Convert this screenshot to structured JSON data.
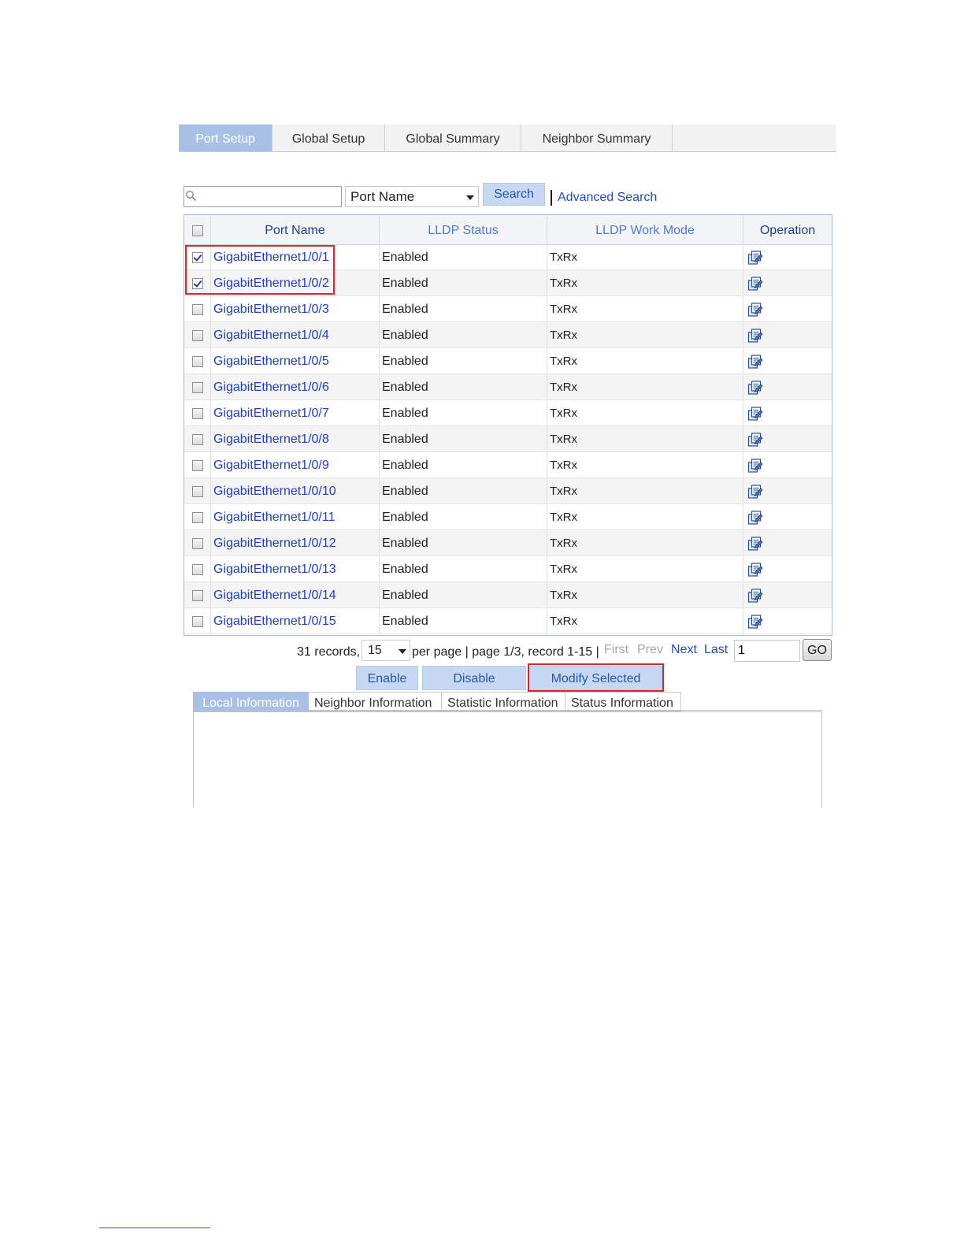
{
  "top_tabs": [
    {
      "label": "Port Setup",
      "active": true
    },
    {
      "label": "Global Setup",
      "active": false
    },
    {
      "label": "Global Summary",
      "active": false
    },
    {
      "label": "Neighbor Summary",
      "active": false
    }
  ],
  "search": {
    "value": "",
    "field": "Port Name",
    "button_label": "Search",
    "separator": "|",
    "advanced_label": "Advanced Search"
  },
  "table": {
    "headers": [
      "Port Name",
      "LLDP Status",
      "LLDP Work Mode",
      "Operation"
    ],
    "rows": [
      {
        "port": "GigabitEthernet1/0/1",
        "status": "Enabled",
        "mode": "TxRx",
        "checked": true
      },
      {
        "port": "GigabitEthernet1/0/2",
        "status": "Enabled",
        "mode": "TxRx",
        "checked": true
      },
      {
        "port": "GigabitEthernet1/0/3",
        "status": "Enabled",
        "mode": "TxRx",
        "checked": false
      },
      {
        "port": "GigabitEthernet1/0/4",
        "status": "Enabled",
        "mode": "TxRx",
        "checked": false
      },
      {
        "port": "GigabitEthernet1/0/5",
        "status": "Enabled",
        "mode": "TxRx",
        "checked": false
      },
      {
        "port": "GigabitEthernet1/0/6",
        "status": "Enabled",
        "mode": "TxRx",
        "checked": false
      },
      {
        "port": "GigabitEthernet1/0/7",
        "status": "Enabled",
        "mode": "TxRx",
        "checked": false
      },
      {
        "port": "GigabitEthernet1/0/8",
        "status": "Enabled",
        "mode": "TxRx",
        "checked": false
      },
      {
        "port": "GigabitEthernet1/0/9",
        "status": "Enabled",
        "mode": "TxRx",
        "checked": false
      },
      {
        "port": "GigabitEthernet1/0/10",
        "status": "Enabled",
        "mode": "TxRx",
        "checked": false
      },
      {
        "port": "GigabitEthernet1/0/11",
        "status": "Enabled",
        "mode": "TxRx",
        "checked": false
      },
      {
        "port": "GigabitEthernet1/0/12",
        "status": "Enabled",
        "mode": "TxRx",
        "checked": false
      },
      {
        "port": "GigabitEthernet1/0/13",
        "status": "Enabled",
        "mode": "TxRx",
        "checked": false
      },
      {
        "port": "GigabitEthernet1/0/14",
        "status": "Enabled",
        "mode": "TxRx",
        "checked": false
      },
      {
        "port": "GigabitEthernet1/0/15",
        "status": "Enabled",
        "mode": "TxRx",
        "checked": false
      }
    ],
    "operation_icon": "edit-icon"
  },
  "pager": {
    "records_text": "31 records,",
    "per_page_value": "15",
    "info_text": "per page | page 1/3, record 1-15 |",
    "first_label": "First",
    "prev_label": "Prev",
    "next_label": "Next",
    "last_label": "Last",
    "page_input_value": "1",
    "go_label": "GO"
  },
  "actions": {
    "enable_label": "Enable",
    "disable_label": "Disable",
    "modify_label": "Modify Selected"
  },
  "bottom_tabs": [
    {
      "label": "Local Information",
      "active": true
    },
    {
      "label": "Neighbor Information",
      "active": false
    },
    {
      "label": "Statistic Information",
      "active": false
    },
    {
      "label": "Status Information",
      "active": false
    }
  ],
  "colors": {
    "active_tab": "#a9c0e6",
    "button_bg": "#c7d9f2",
    "link": "#1d3fc4",
    "highlight": "#d9272e"
  }
}
